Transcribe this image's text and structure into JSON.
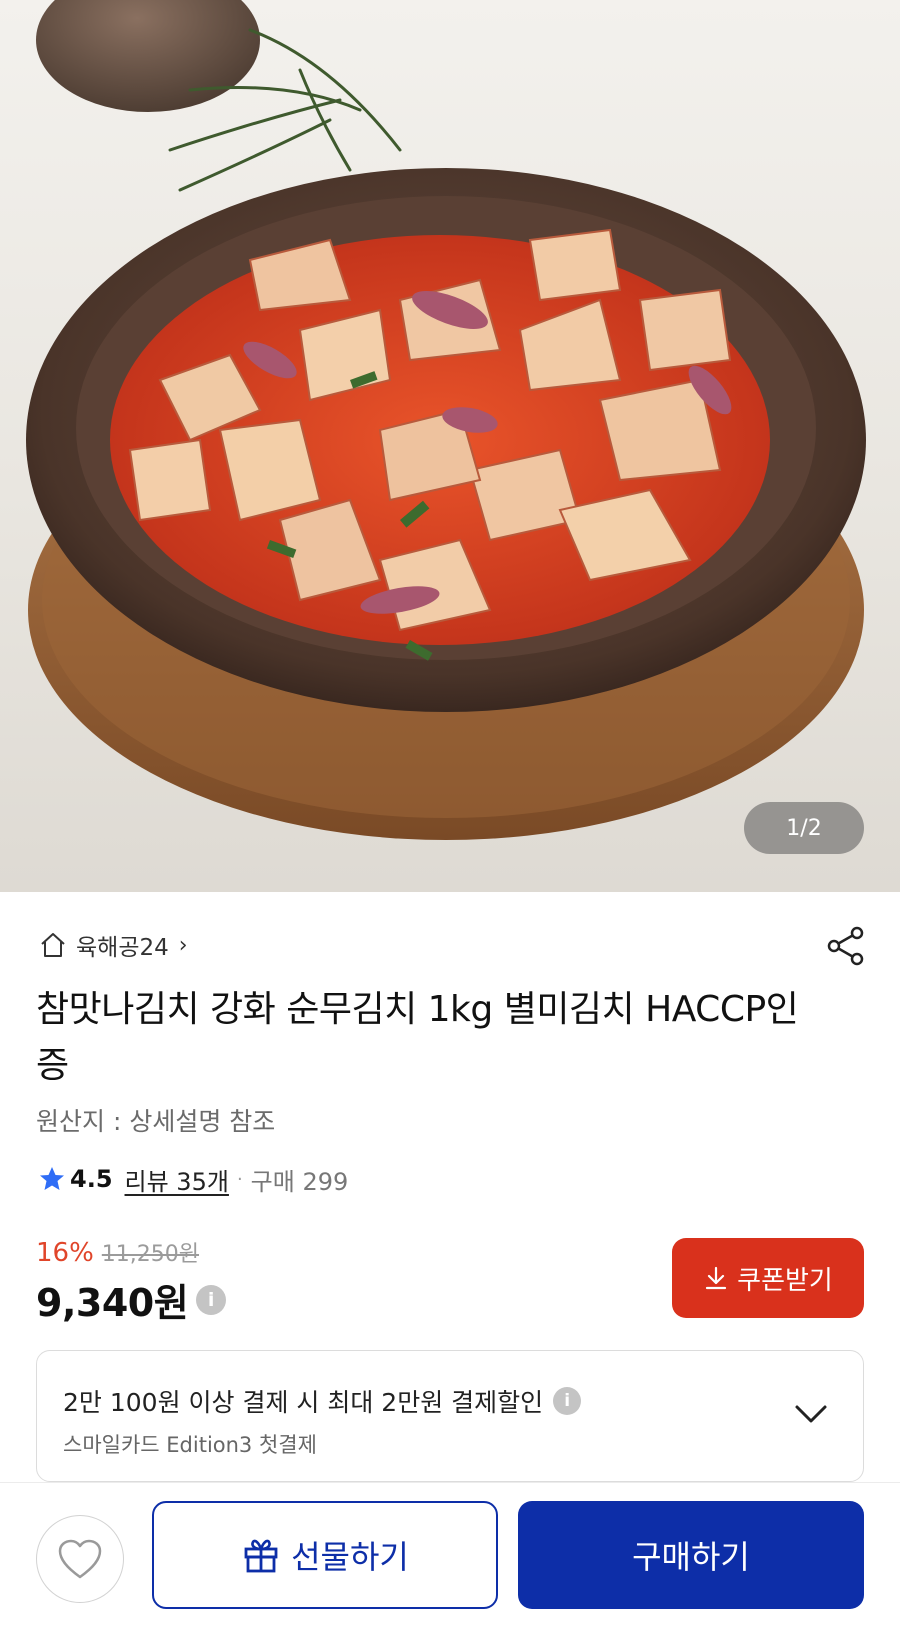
{
  "gallery": {
    "counter": "1/2"
  },
  "store": {
    "name": "육해공24",
    "chevron": "›",
    "home_icon": "home-icon",
    "share_icon": "share-icon"
  },
  "product": {
    "title": "참맛나김치 강화 순무김치 1kg 별미김치 HACCP인증",
    "origin": "원산지 : 상세설명 참조"
  },
  "rating": {
    "value": "4.5",
    "review_link": "리뷰 35개",
    "separator": "·",
    "purchase_count": "구매 299"
  },
  "price": {
    "discount_rate": "16%",
    "original_price": "11,250원",
    "sale_price": "9,340원",
    "info_glyph": "i"
  },
  "coupon": {
    "label": "쿠폰받기"
  },
  "promo": {
    "main_text": "2만 100원 이상 결제 시 최대 2만원 결제할인",
    "sub_text": "스마일카드 Edition3 첫결제"
  },
  "actions": {
    "gift_label": "선물하기",
    "buy_label": "구매하기"
  },
  "colors": {
    "accent_blue": "#0d2ea8",
    "coupon_red": "#d9311c",
    "discount_red": "#e0452a",
    "star_blue": "#2f6df6"
  }
}
